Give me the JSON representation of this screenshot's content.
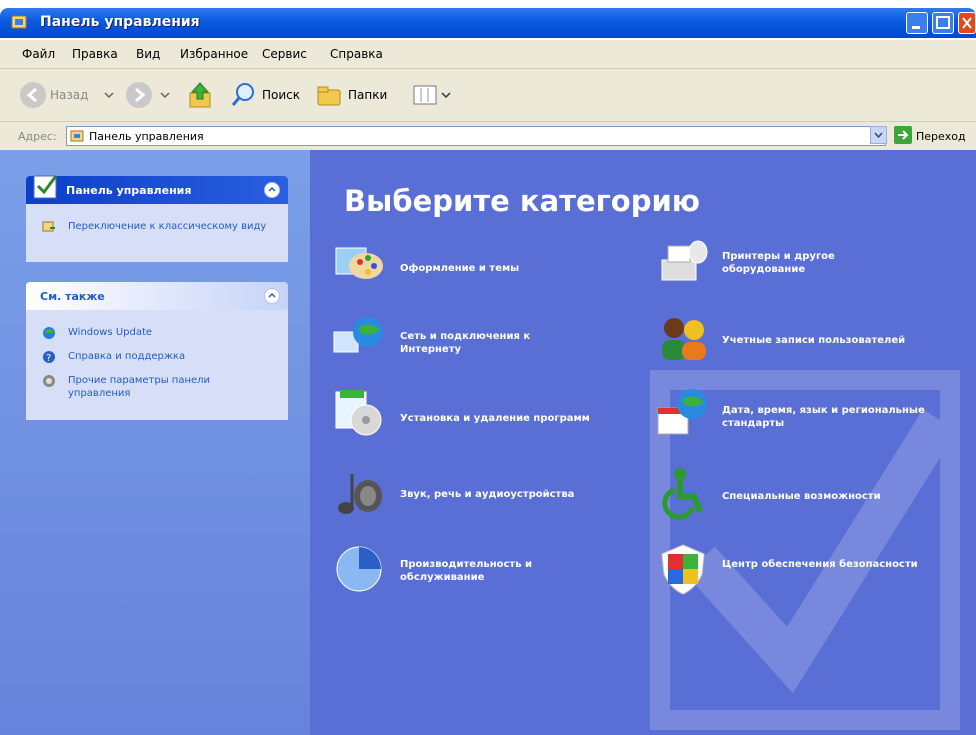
{
  "window": {
    "title": "Панель управления"
  },
  "menu": [
    "Файл",
    "Правка",
    "Вид",
    "Избранное",
    "Сервис",
    "Справка"
  ],
  "toolbar": {
    "back": "Назад",
    "search": "Поиск",
    "folders": "Папки"
  },
  "address": {
    "label": "Адрес:",
    "value": "Панель управления",
    "go": "Переход"
  },
  "sidebar": {
    "control_panel": {
      "title": "Панель управления",
      "link": "Переключение к классическому виду"
    },
    "see_also": {
      "title": "См. также",
      "links": [
        "Windows Update",
        "Справка и поддержка",
        "Прочие параметры панели управления"
      ]
    }
  },
  "main": {
    "heading": "Выберите категорию",
    "categories": [
      {
        "label": "Оформление и темы",
        "icon": "appearance-icon"
      },
      {
        "label": "Принтеры и другое оборудование",
        "icon": "printer-icon"
      },
      {
        "label": "Сеть и подключения к Интернету",
        "icon": "network-icon"
      },
      {
        "label": "Учетные записи пользователей",
        "icon": "users-icon"
      },
      {
        "label": "Установка и удаление программ",
        "icon": "add-remove-programs-icon"
      },
      {
        "label": "Дата, время, язык и региональные стандарты",
        "icon": "date-time-icon"
      },
      {
        "label": "Звук, речь и аудиоустройства",
        "icon": "sound-icon"
      },
      {
        "label": "Специальные возможности",
        "icon": "accessibility-icon"
      },
      {
        "label": "Производительность и обслуживание",
        "icon": "performance-icon"
      },
      {
        "label": "Центр обеспечения безопасности",
        "icon": "security-shield-icon"
      }
    ]
  },
  "colors": {
    "accent": "#0054e3",
    "pane": "#5a6fd6",
    "sidebar": "#7b9fe8"
  }
}
